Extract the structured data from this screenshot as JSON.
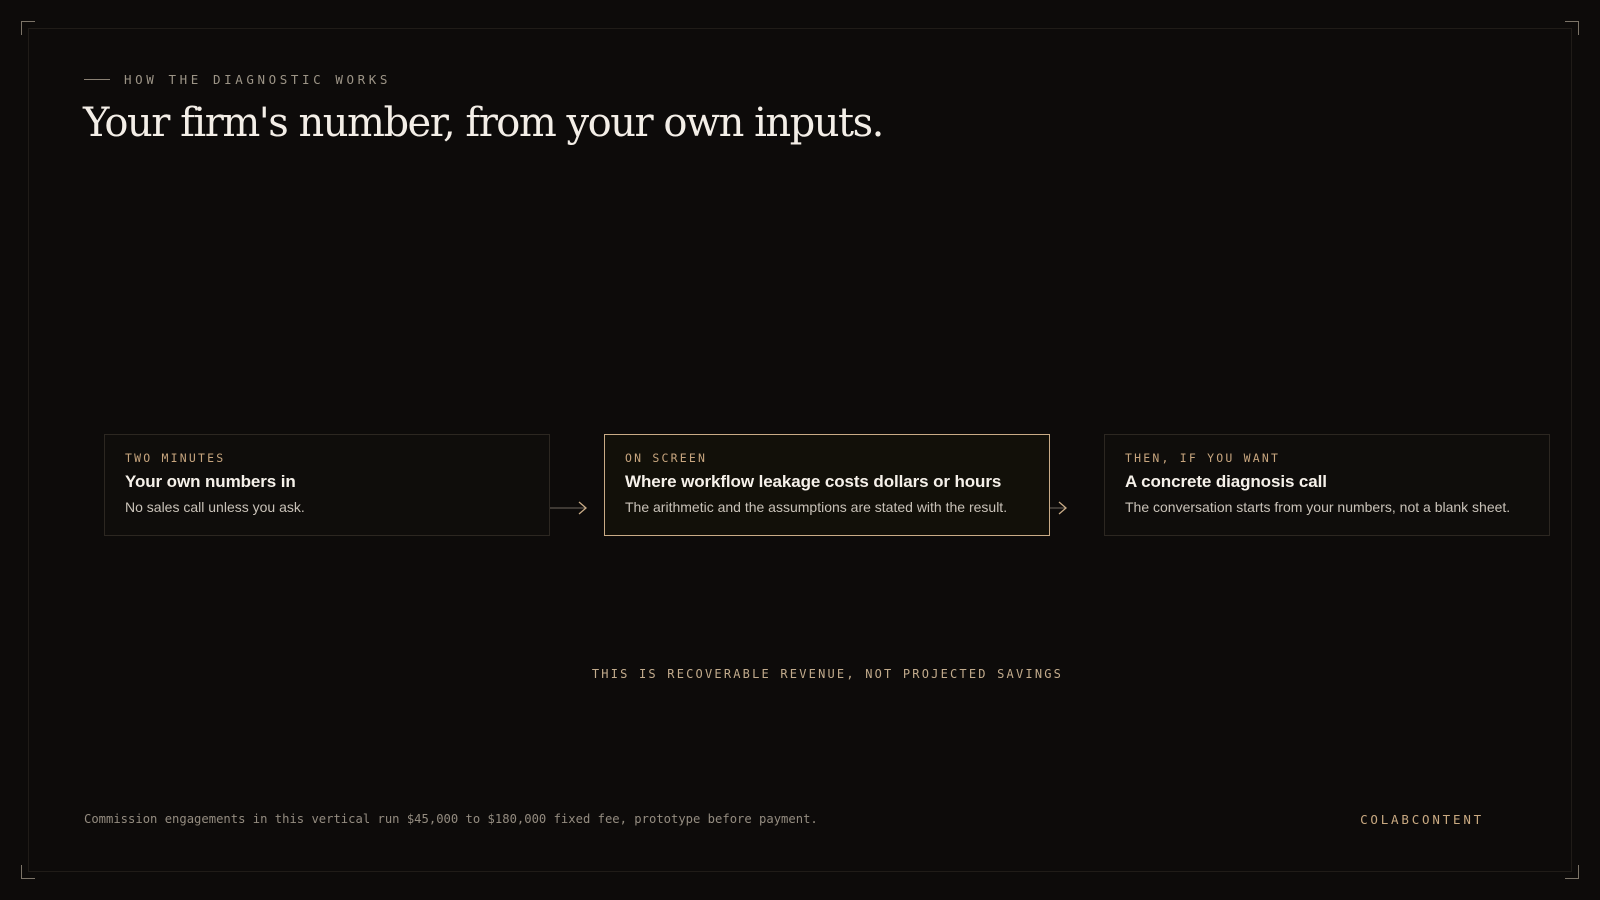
{
  "header": {
    "eyebrow": "HOW THE DIAGNOSTIC WORKS",
    "title": "Your firm's number, from your own inputs."
  },
  "steps": [
    {
      "label": "TWO MINUTES",
      "title": "Your own numbers in",
      "desc": "No sales call unless you ask."
    },
    {
      "label": "ON SCREEN",
      "title": "Where workflow leakage costs dollars or hours",
      "desc": "The arithmetic and the assumptions are stated with the result."
    },
    {
      "label": "THEN, IF YOU WANT",
      "title": "A concrete diagnosis call",
      "desc": "The conversation starts from your numbers, not a blank sheet."
    }
  ],
  "note": "THIS IS RECOVERABLE REVENUE, NOT PROJECTED SAVINGS",
  "footer": {
    "note": "Commission engagements in this vertical run $45,000 to $180,000 fixed fee, prototype before payment.",
    "brand": "COLABCONTENT"
  },
  "colors": {
    "background": "#0d0b0a",
    "accent": "#c9ab86",
    "text": "#f3eee7"
  }
}
